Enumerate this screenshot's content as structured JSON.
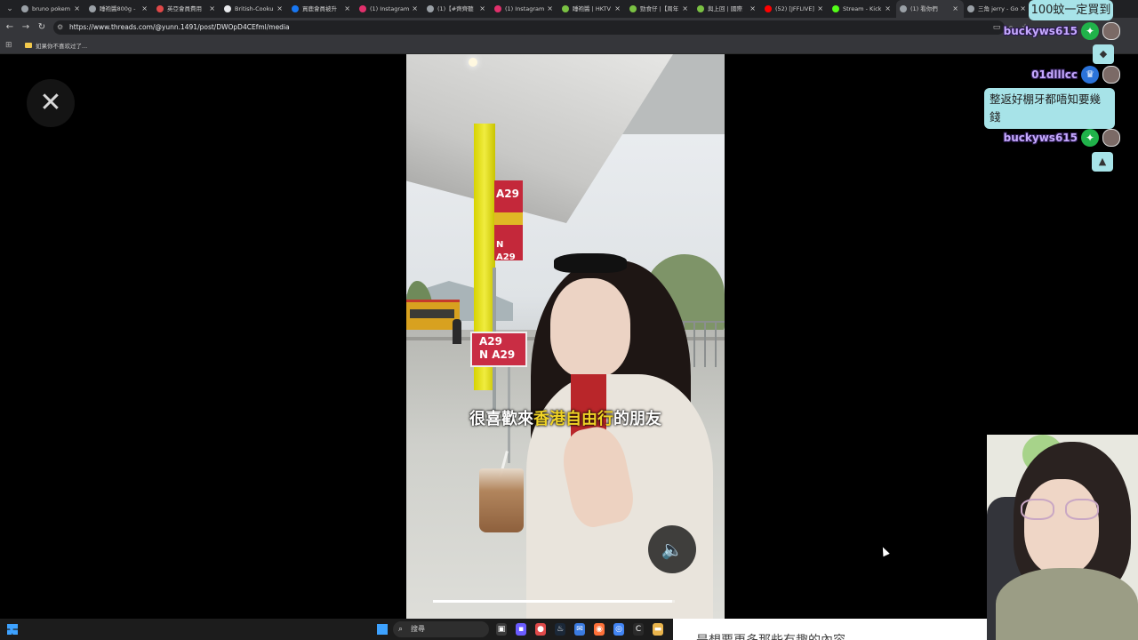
{
  "browser": {
    "tabs": [
      {
        "title": "bruno pokem",
        "color": "#9aa0a6"
      },
      {
        "title": "睡袍醬800g -",
        "color": "#9aa0a6"
      },
      {
        "title": "英亞會員費用",
        "color": "#e04848"
      },
      {
        "title": "British-Cooku",
        "color": "#e8eaed"
      },
      {
        "title": "買鹿會員被升",
        "color": "#1877f2"
      },
      {
        "title": "(1) Instagram",
        "color": "#e1306c"
      },
      {
        "title": "(1)【#齊齊聽",
        "color": "#9aa0a6"
      },
      {
        "title": "(1) Instagram",
        "color": "#e1306c"
      },
      {
        "title": "睡袍醬 | HKTV",
        "color": "#7ac143"
      },
      {
        "title": "勁食仔 |【周年",
        "color": "#7ac143"
      },
      {
        "title": "與上回 | 國際",
        "color": "#7ac143"
      },
      {
        "title": "(52) [JFFLIVE]",
        "color": "#ff0000"
      },
      {
        "title": "Stream - Kick",
        "color": "#53fc18"
      },
      {
        "title": "(1) 看你們",
        "color": "#9aa0a6",
        "active": true
      },
      {
        "title": "三角 jerry - Go",
        "color": "#9aa0a6"
      }
    ],
    "url": "https://www.threads.com/@yunn.1491/post/DWOpD4CEfml/media",
    "bookmark": "如果你不喜欢过了..."
  },
  "video": {
    "caption_before": "很喜歡來",
    "caption_highlight": "香港自由行",
    "caption_after": "的朋友",
    "sign_route": "A29",
    "sign_route_n": "N A29",
    "progress": 0.99
  },
  "chat": {
    "banner": "100蚊一定買到",
    "messages": [
      {
        "user": "buckyws615",
        "badge": "star-badge-icon"
      },
      {
        "user": "01dlllcc",
        "badge": "crown-badge-icon"
      },
      {
        "text": "整返好棚牙都唔知要幾錢"
      },
      {
        "user": "buckyws615",
        "badge": "star-badge-icon"
      }
    ]
  },
  "taskbar": {
    "search_label": "搜尋"
  },
  "strip_text": "是想要更多那些有趣的內容"
}
